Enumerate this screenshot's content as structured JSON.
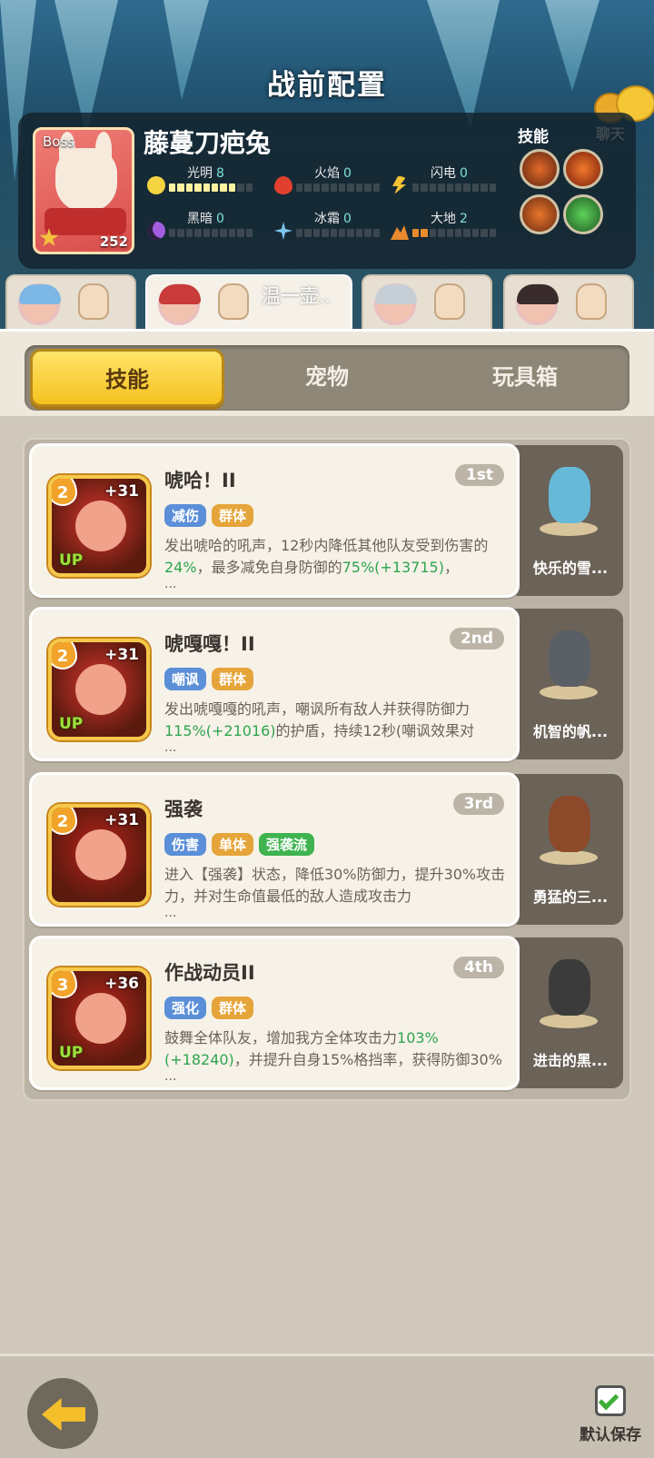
{
  "header": {
    "title": "战前配置",
    "chat_label": "聊天"
  },
  "boss": {
    "tag": "Boss",
    "name": "藤蔓刀疤兔",
    "level": "252",
    "stats": [
      {
        "name": "光明",
        "value": "8",
        "icon": "sun-icon",
        "color": "#f5d442",
        "level": 8
      },
      {
        "name": "火焰",
        "value": "0",
        "icon": "flame-icon",
        "color": "#e2402e",
        "level": 0
      },
      {
        "name": "闪电",
        "value": "0",
        "icon": "lightning-icon",
        "color": "#f3c334",
        "level": 0
      },
      {
        "name": "黑暗",
        "value": "0",
        "icon": "moon-icon",
        "color": "#a35ee0",
        "level": 0
      },
      {
        "name": "冰霜",
        "value": "0",
        "icon": "snowflake-icon",
        "color": "#7cc8f0",
        "level": 0
      },
      {
        "name": "大地",
        "value": "2",
        "icon": "mountain-icon",
        "color": "#e98a2c",
        "level": 2
      }
    ],
    "skills_label": "技能"
  },
  "heroes": [
    {
      "name": "",
      "hair": "#7db7e6"
    },
    {
      "name": "温一壶..",
      "hair": "#c93b3b"
    },
    {
      "name": "",
      "hair": "#c7cfd6"
    },
    {
      "name": "",
      "hair": "#3a2c2c"
    }
  ],
  "tabs": [
    "技能",
    "宠物",
    "玩具箱"
  ],
  "skills": [
    {
      "level": "2",
      "plus": "+31",
      "up": "UP",
      "name": "唬哈！II",
      "rank": "1st",
      "tags": [
        {
          "t": "减伤",
          "c": "#5b8fd8"
        },
        {
          "t": "群体",
          "c": "#e5a53a"
        }
      ],
      "desc_a": "发出唬哈的吼声，12秒内降低其他队友受到伤害的",
      "desc_b": "24%",
      "desc_c": "，最多减免自身防御的",
      "desc_d": "75%(+13715)",
      "desc_e": "，",
      "ell": "...",
      "color": "#d8362f",
      "pet": {
        "name": "快乐的雪...",
        "color": "#67b9d8"
      }
    },
    {
      "level": "2",
      "plus": "+31",
      "up": "UP",
      "name": "唬嘎嘎！II",
      "rank": "2nd",
      "tags": [
        {
          "t": "嘲讽",
          "c": "#5b8fd8"
        },
        {
          "t": "群体",
          "c": "#e5a53a"
        }
      ],
      "desc_a": "发出唬嘎嘎的吼声，嘲讽所有敌人并获得防御力",
      "desc_b": "115%(+21016)",
      "desc_c": "的护盾，持续12秒(嘲讽效果对",
      "desc_d": "",
      "desc_e": "",
      "ell": "...",
      "color": "#d8362f",
      "pet": {
        "name": "机智的帆...",
        "color": "#5a5f66"
      }
    },
    {
      "level": "2",
      "plus": "+31",
      "up": "",
      "name": "强袭",
      "rank": "3rd",
      "tags": [
        {
          "t": "伤害",
          "c": "#5b8fd8"
        },
        {
          "t": "单体",
          "c": "#e5a53a"
        },
        {
          "t": "强袭流",
          "c": "#3fb34f"
        }
      ],
      "desc_a": "进入【强袭】状态，降低30%防御力，提升30%攻击力，并对生命值最低的敌人造成攻击力",
      "desc_b": "",
      "desc_c": "",
      "desc_d": "",
      "desc_e": "",
      "ell": "...",
      "color": "#b7221b",
      "pet": {
        "name": "勇猛的三...",
        "color": "#8c4a2b"
      }
    },
    {
      "level": "3",
      "plus": "+36",
      "up": "UP",
      "name": "作战动员II",
      "rank": "4th",
      "tags": [
        {
          "t": "强化",
          "c": "#5b8fd8"
        },
        {
          "t": "群体",
          "c": "#e5a53a"
        }
      ],
      "desc_a": "鼓舞全体队友，增加我方全体攻击力",
      "desc_b": "103%(+18240)",
      "desc_c": "，并提升自身15%格挡率，获得防御30%",
      "desc_d": "",
      "desc_e": "",
      "ell": "...",
      "color": "#c0271f",
      "pet": {
        "name": "进击的黑...",
        "color": "#3b3b3b"
      }
    }
  ],
  "footer": {
    "save_label": "默认保存"
  }
}
